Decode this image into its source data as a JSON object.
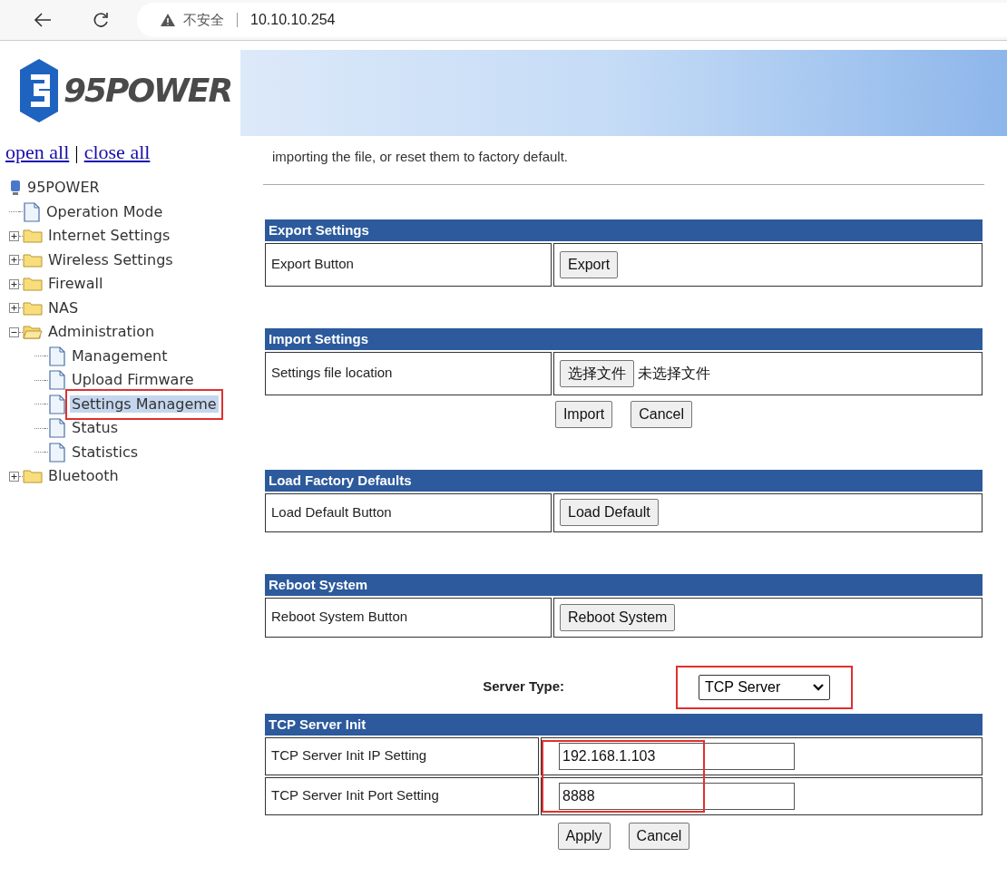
{
  "browser": {
    "security_label": "不安全",
    "url": "10.10.10.254"
  },
  "sidebar": {
    "logo_text": "95POWER",
    "links": [
      {
        "label": "open all"
      },
      {
        "label": "close all"
      }
    ],
    "link_separator": "|",
    "tree": {
      "label": "95POWER",
      "children": [
        {
          "label": "Operation Mode",
          "kind": "page",
          "selected": false,
          "marked": false
        },
        {
          "label": "Internet Settings",
          "kind": "folder",
          "expanded": false
        },
        {
          "label": "Wireless Settings",
          "kind": "folder",
          "expanded": false
        },
        {
          "label": "Firewall",
          "kind": "folder",
          "expanded": false
        },
        {
          "label": "NAS",
          "kind": "folder",
          "expanded": false
        },
        {
          "label": "Administration",
          "kind": "folder",
          "expanded": true,
          "children": [
            {
              "label": "Management",
              "kind": "page",
              "selected": false,
              "marked": false
            },
            {
              "label": "Upload Firmware",
              "kind": "page",
              "selected": false,
              "marked": false
            },
            {
              "label": "Settings Manageme",
              "kind": "page",
              "selected": true,
              "marked": true
            },
            {
              "label": "Status",
              "kind": "page",
              "selected": false,
              "marked": false
            },
            {
              "label": "Statistics",
              "kind": "page",
              "selected": false,
              "marked": false
            }
          ]
        },
        {
          "label": "Bluetooth",
          "kind": "folder",
          "expanded": false
        }
      ]
    }
  },
  "content": {
    "intro": "importing the file, or reset them to factory default.",
    "sections": [
      {
        "title": "Export Settings",
        "label": "Export Button",
        "kind": "button",
        "button": "Export"
      },
      {
        "title": "Import Settings",
        "label": "Settings file location",
        "kind": "file",
        "file_button": "选择文件",
        "file_status": "未选择文件",
        "actions": [
          "Import",
          "Cancel"
        ]
      },
      {
        "title": "Load Factory Defaults",
        "label": "Load Default Button",
        "kind": "button",
        "button": "Load Default"
      },
      {
        "title": "Reboot System",
        "label": "Reboot System Button",
        "kind": "button",
        "button": "Reboot System"
      }
    ],
    "server_type": {
      "label": "Server Type:",
      "value": "TCP Server",
      "marked": true
    },
    "tcp_init": {
      "title": "TCP Server Init",
      "marked": true,
      "rows": [
        {
          "label": "TCP Server Init IP Setting",
          "value": "192.168.1.103"
        },
        {
          "label": "TCP Server Init Port Setting",
          "value": "8888"
        }
      ],
      "actions": [
        "Apply",
        "Cancel"
      ]
    }
  }
}
